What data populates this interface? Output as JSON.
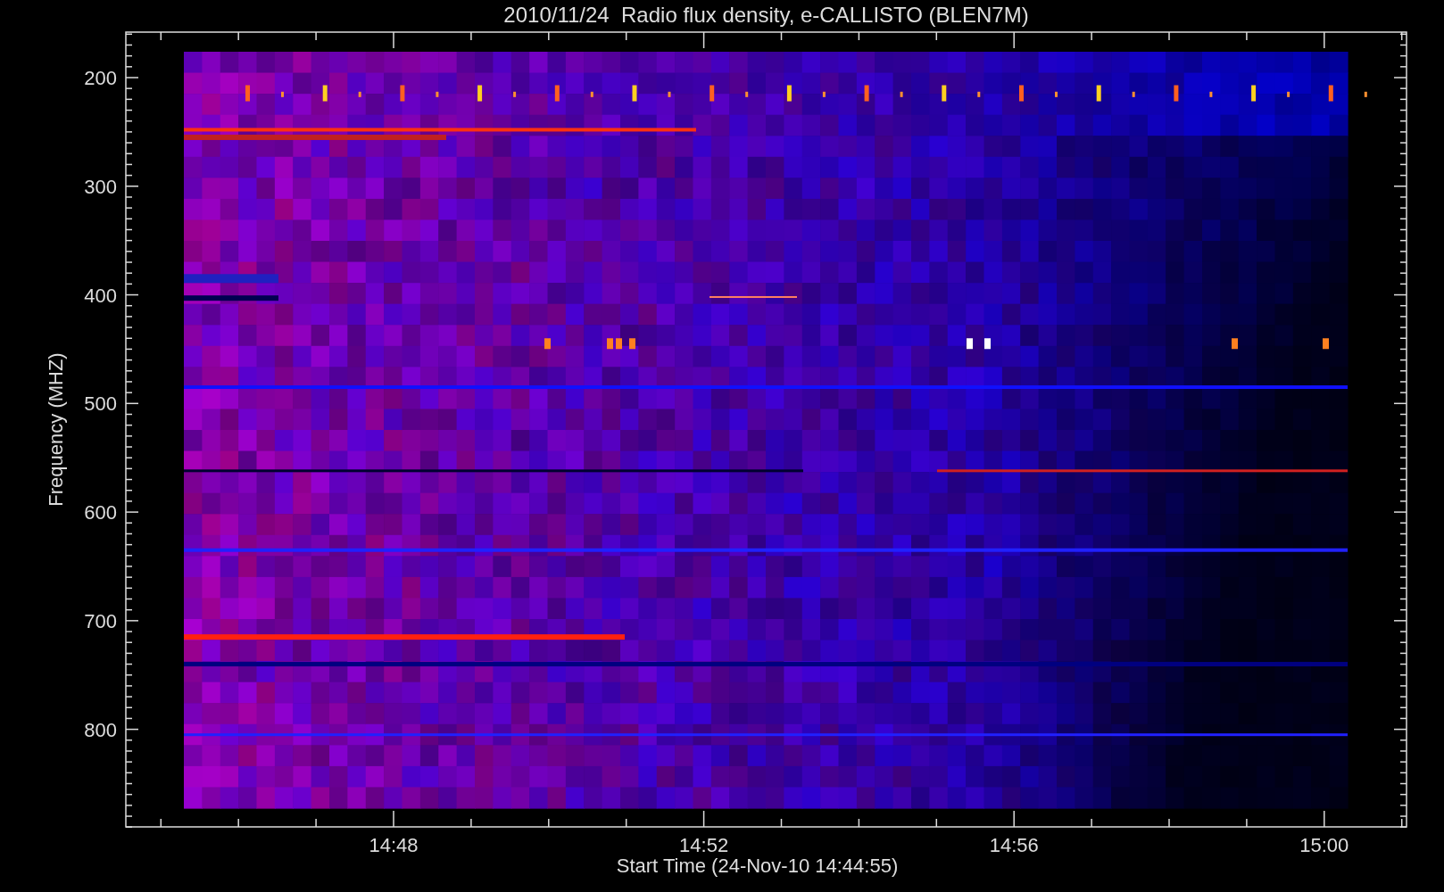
{
  "title": "2010/11/24  Radio flux density, e-CALLISTO (BLEN7M)",
  "y_axis": {
    "label": "Frequency (MHZ)",
    "ticks": [
      "200",
      "300",
      "400",
      "500",
      "600",
      "700",
      "800"
    ]
  },
  "x_axis": {
    "label": "Start Time (24-Nov-10 14:44:55)",
    "ticks": [
      "14:48",
      "14:52",
      "14:56",
      "15:00"
    ]
  }
}
